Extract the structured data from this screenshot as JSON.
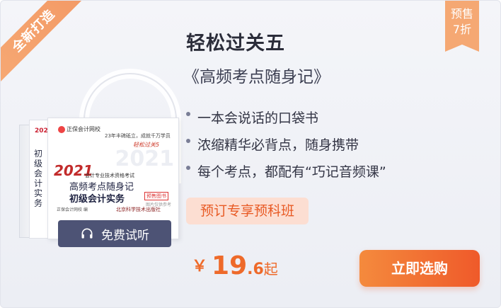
{
  "ribbon": {
    "label": "全新打造"
  },
  "product": {
    "title": "轻松过关五",
    "subtitle": "《高频考点随身记》"
  },
  "features": [
    {
      "text": "一本会说话的口袋书"
    },
    {
      "text": "浓缩精华必背点，随身携带"
    },
    {
      "text": "每个考点，都配有“巧记音频课”"
    }
  ],
  "promo": {
    "label": "预订专享预科班"
  },
  "price": {
    "symbol": "￥",
    "integer": "19",
    "decimal": ".6",
    "suffix": "起"
  },
  "buttons": {
    "buy_label": "立即选购",
    "listen_label": "免费试听"
  },
  "discount": {
    "line1": "预售",
    "line2": "7折"
  },
  "book": {
    "logo": "正保会计网校",
    "slogan": "23年丰碑砥立，成就千万学员",
    "signature": "轻松过关5",
    "year": "2021",
    "series": "会计专业技术资格考试",
    "title_line1": "高频考点随身记",
    "title_line2": "初级会计实务",
    "tag": "预售图书",
    "tag2": "图片仅供参考",
    "editor": "正保会计网校  编",
    "publisher": "北京科学技术出版社",
    "spine_title": "初级会计实务",
    "spine_year": "2021"
  },
  "colors": {
    "accent": "#ef5a2a",
    "price": "#ee6a2a",
    "ribbon": "#f6a873",
    "listen_button": "#4d5375"
  },
  "icons": {
    "listen": "headphones-icon"
  }
}
